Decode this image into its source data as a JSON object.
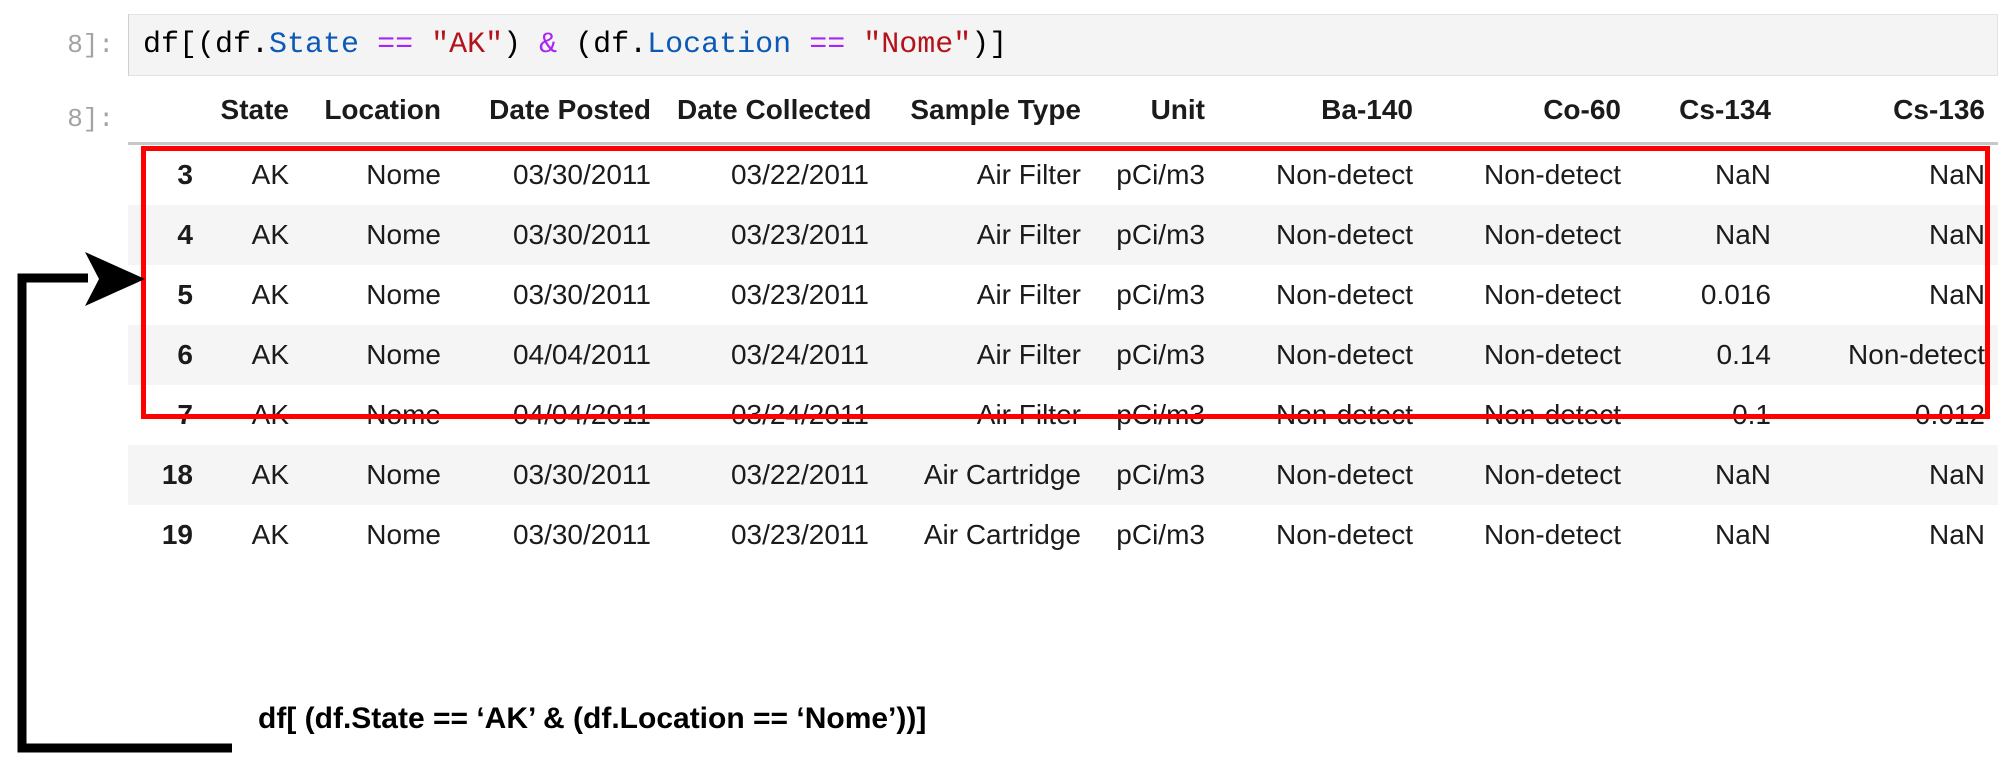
{
  "notebook": {
    "input_prompt": "8]:",
    "output_prompt": "8]:",
    "code_tokens": [
      {
        "text": "df[(df.",
        "type": "plain"
      },
      {
        "text": "State",
        "type": "attr"
      },
      {
        "text": " ",
        "type": "plain"
      },
      {
        "text": "==",
        "type": "op"
      },
      {
        "text": " ",
        "type": "plain"
      },
      {
        "text": "\"AK\"",
        "type": "str"
      },
      {
        "text": ") ",
        "type": "plain"
      },
      {
        "text": "&",
        "type": "op"
      },
      {
        "text": " (df.",
        "type": "plain"
      },
      {
        "text": "Location",
        "type": "attr"
      },
      {
        "text": " ",
        "type": "plain"
      },
      {
        "text": "==",
        "type": "op"
      },
      {
        "text": " ",
        "type": "plain"
      },
      {
        "text": "\"Nome\"",
        "type": "str"
      },
      {
        "text": ")]",
        "type": "plain"
      }
    ],
    "code_plain": "df[(df.State == \"AK\") & (df.Location == \"Nome\")]"
  },
  "dataframe": {
    "index_header": "",
    "columns": [
      "State",
      "Location",
      "Date Posted",
      "Date Collected",
      "Sample Type",
      "Unit",
      "Ba-140",
      "Co-60",
      "Cs-134",
      "Cs-136"
    ],
    "rows": [
      {
        "index": "3",
        "State": "AK",
        "Location": "Nome",
        "Date Posted": "03/30/2011",
        "Date Collected": "03/22/2011",
        "Sample Type": "Air Filter",
        "Unit": "pCi/m3",
        "Ba-140": "Non-detect",
        "Co-60": "Non-detect",
        "Cs-134": "NaN",
        "Cs-136": "NaN",
        "highlighted": true
      },
      {
        "index": "4",
        "State": "AK",
        "Location": "Nome",
        "Date Posted": "03/30/2011",
        "Date Collected": "03/23/2011",
        "Sample Type": "Air Filter",
        "Unit": "pCi/m3",
        "Ba-140": "Non-detect",
        "Co-60": "Non-detect",
        "Cs-134": "NaN",
        "Cs-136": "NaN",
        "highlighted": true
      },
      {
        "index": "5",
        "State": "AK",
        "Location": "Nome",
        "Date Posted": "03/30/2011",
        "Date Collected": "03/23/2011",
        "Sample Type": "Air Filter",
        "Unit": "pCi/m3",
        "Ba-140": "Non-detect",
        "Co-60": "Non-detect",
        "Cs-134": "0.016",
        "Cs-136": "NaN",
        "highlighted": true
      },
      {
        "index": "6",
        "State": "AK",
        "Location": "Nome",
        "Date Posted": "04/04/2011",
        "Date Collected": "03/24/2011",
        "Sample Type": "Air Filter",
        "Unit": "pCi/m3",
        "Ba-140": "Non-detect",
        "Co-60": "Non-detect",
        "Cs-134": "0.14",
        "Cs-136": "Non-detect",
        "highlighted": true
      },
      {
        "index": "7",
        "State": "AK",
        "Location": "Nome",
        "Date Posted": "04/04/2011",
        "Date Collected": "03/24/2011",
        "Sample Type": "Air Filter",
        "Unit": "pCi/m3",
        "Ba-140": "Non-detect",
        "Co-60": "Non-detect",
        "Cs-134": "0.1",
        "Cs-136": "0.012",
        "highlighted": true
      },
      {
        "index": "18",
        "State": "AK",
        "Location": "Nome",
        "Date Posted": "03/30/2011",
        "Date Collected": "03/22/2011",
        "Sample Type": "Air Cartridge",
        "Unit": "pCi/m3",
        "Ba-140": "Non-detect",
        "Co-60": "Non-detect",
        "Cs-134": "NaN",
        "Cs-136": "NaN",
        "highlighted": false
      },
      {
        "index": "19",
        "State": "AK",
        "Location": "Nome",
        "Date Posted": "03/30/2011",
        "Date Collected": "03/23/2011",
        "Sample Type": "Air Cartridge",
        "Unit": "pCi/m3",
        "Ba-140": "Non-detect",
        "Co-60": "Non-detect",
        "Cs-134": "NaN",
        "Cs-136": "NaN",
        "highlighted": false
      }
    ]
  },
  "annotation": {
    "label": "df[ (df.State == ‘AK’ & (df.Location == ‘Nome’))]",
    "arrow_color": "#000000",
    "highlight_color": "#ff0000"
  }
}
